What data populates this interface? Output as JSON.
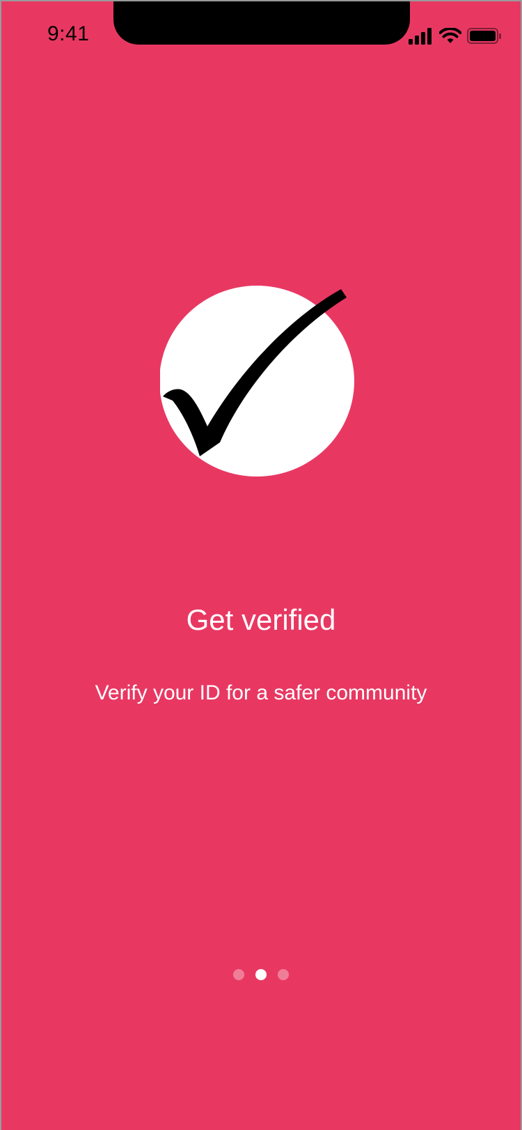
{
  "status_bar": {
    "time": "9:41",
    "icons": [
      "cellular-signal-icon",
      "wifi-icon",
      "battery-icon"
    ]
  },
  "onboarding": {
    "title": "Get verified",
    "subtitle": "Verify your ID for a safer community",
    "illustration": "checkmark-circle-icon",
    "page_indicator": {
      "total": 3,
      "active_index": 1
    }
  },
  "colors": {
    "background": "#e83862",
    "text": "#ffffff",
    "circle": "#ffffff",
    "check": "#000000"
  }
}
